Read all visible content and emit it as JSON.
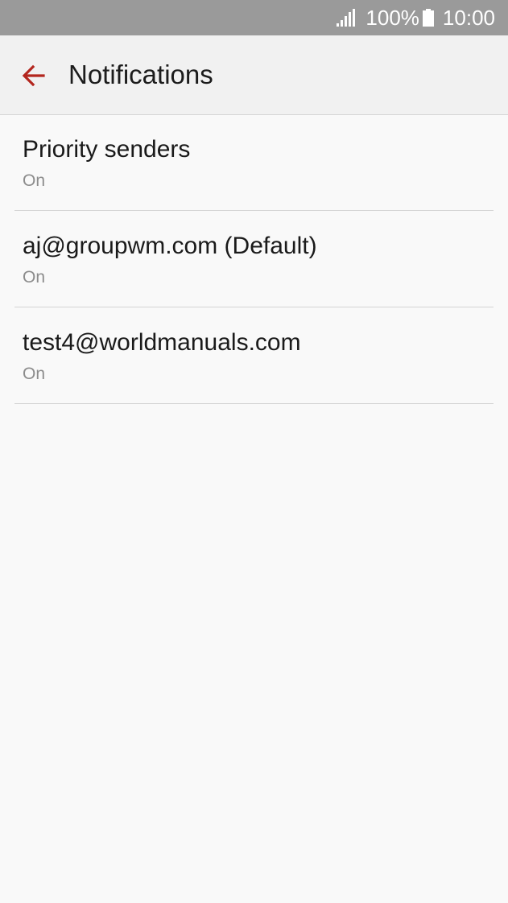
{
  "status_bar": {
    "battery_percent": "100%",
    "time": "10:00",
    "signal_icon": "signal-icon",
    "battery_icon": "battery-icon"
  },
  "app_bar": {
    "back_icon": "arrow-back-icon",
    "title": "Notifications",
    "accent_color": "#b3261e"
  },
  "list": {
    "items": [
      {
        "title": "Priority senders",
        "status": "On"
      },
      {
        "title": "aj@groupwm.com (Default)",
        "status": "On"
      },
      {
        "title": "test4@worldmanuals.com",
        "status": "On"
      }
    ]
  }
}
